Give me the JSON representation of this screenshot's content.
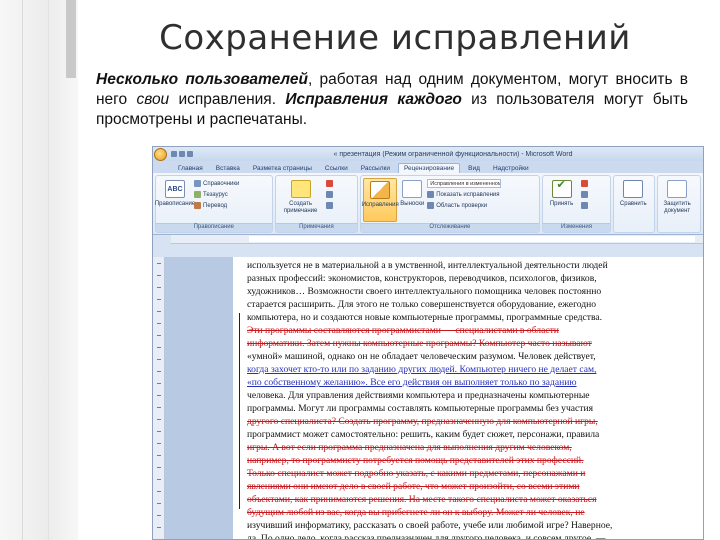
{
  "slide": {
    "title": "Сохранение исправлений",
    "body": {
      "p1_bi": "Несколько пользователей",
      "p2": ", работая над одним документом, могут вносить в него ",
      "p3_it": "свои",
      "p4": " исправления. ",
      "p5_bi": "Исправления каждого",
      "p6": " из пользователя могут быть просмотрены и распечатаны."
    }
  },
  "word": {
    "title": "« презентация (Режим ограниченной функциональности) - Microsoft Word",
    "tabs": [
      "Главная",
      "Вставка",
      "Разметка страницы",
      "Ссылки",
      "Рассылки",
      "Рецензирование",
      "Вид",
      "Надстройки"
    ],
    "active_tab": "Рецензирование",
    "ribbon": {
      "proofing_label": "Правописание",
      "proofing_big": "Правописание",
      "proofing_small": [
        "Справочники",
        "Тезаурус",
        "Перевод"
      ],
      "comments_label": "Примечания",
      "comments_big": "Создать примечание",
      "tracking_label": "Отслеживание",
      "tracking_big": "Исправления",
      "balloons": "Выноски",
      "markup_select": "Исправления в измененном документе",
      "show_markup": "Показать исправления",
      "reviewing_pane": "Область проверки",
      "changes_label": "Изменения",
      "accept_big": "Принять",
      "compare_big": "Сравнить",
      "protect_big": "Защитить документ"
    },
    "doc_lines": [
      {
        "t": "используется не в материальной а в умственной, интеллектуальной деятельности людей"
      },
      {
        "t": "разных профессий: экономистов, конструкторов, переводчиков, психологов, физиков,"
      },
      {
        "t": "художников… Возможности своего интеллектуального помощника человек постоянно"
      },
      {
        "t": "старается расширить. Для этого не только совершенствуется оборудование, ежегодно"
      },
      {
        "t": "компьютера, но и создаются новые компьютерные программы, программные средства."
      },
      {
        "t": "Эти программы составляются программистами — специалистами в области",
        "cls": "del"
      },
      {
        "t": "информатики. Затем нужны компьютерные программы? Компьютер часто называют",
        "cls": "del"
      },
      {
        "t": "«умной» машиной, однако он не обладает человеческим разумом. Человек действует,"
      },
      {
        "t": "когда захочет кто-то или по заданию других людей. Компьютер ничего не делает сам,",
        "cls": "ins"
      },
      {
        "t": "«по собственному желанию». Все его действия он выполняет только по заданию",
        "cls": "ins"
      },
      {
        "t": "человека. Для управления действиями компьютера и предназначены компьютерные"
      },
      {
        "t": "программы. Могут ли программы составлять компьютерные программы без участия"
      },
      {
        "t": "другого специалиста? Создать программу, предназначенную для компьютерной игры,",
        "cls": "del"
      },
      {
        "t": "программист может самостоятельно: решить, каким будет сюжет, персонажи, правила"
      },
      {
        "t": "игры. А вот если программа предназначена для выполнения другим человеком,",
        "cls": "del"
      },
      {
        "t": "например, то программисту потребуется помощь представителей этих профессий.",
        "cls": "del"
      },
      {
        "t": "Только специалист может подробно указать, с какими предметами, персонажами и",
        "cls": "del"
      },
      {
        "t": "явлениями они имеют дело в своей работе, что может произойти, со всеми этими",
        "cls": "del"
      },
      {
        "t": "объектами, как принимаются решения. На месте такого специалиста может оказаться",
        "cls": "del"
      },
      {
        "t": "будущим любой из вас, когда вы прибегнете ли он к выбору. Может ли человек, не",
        "cls": "del"
      },
      {
        "t": "изучивший информатику, рассказать о своей работе, учебе или любимой игре? Наверное,"
      },
      {
        "t": "да. По одно дело, когда рассказ предназначен для другого человека, и совсем другое, —"
      },
      {
        "t": "когда сведения нужны для создания компьютерной программы. Объясни, что-то"
      }
    ]
  }
}
